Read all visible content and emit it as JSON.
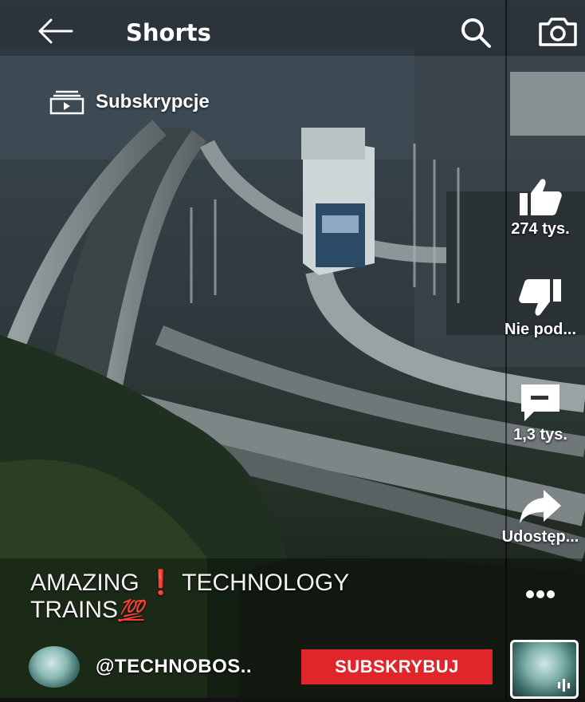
{
  "header": {
    "title": "Shorts",
    "back_icon": "arrow-left-icon",
    "search_icon": "search-icon",
    "camera_icon": "camera-icon"
  },
  "subscriptions": {
    "label": "Subskrypcje",
    "icon": "subscriptions-icon"
  },
  "actions": {
    "like": {
      "label": "274 tys.",
      "icon": "thumbs-up-icon"
    },
    "dislike": {
      "label": "Nie pod...",
      "icon": "thumbs-down-icon"
    },
    "comments": {
      "label": "1,3 tys.",
      "icon": "comment-icon"
    },
    "share": {
      "label": "Udostęp...",
      "icon": "share-arrow-icon"
    },
    "more": {
      "icon": "more-dots-icon"
    }
  },
  "video": {
    "caption_part1": "AMAZING",
    "caption_emoji": "❗",
    "caption_part2": "TECHNOLOGY",
    "caption_part3": "TRAINS",
    "caption_emoji2": "💯"
  },
  "channel": {
    "name": "@TECHNOBOS..",
    "subscribe_label": "SUBSKRYBUJ"
  },
  "colors": {
    "subscribe_bg": "#e0262b",
    "text": "#ffffff",
    "accent_exclamation": "#2aa8ff"
  }
}
